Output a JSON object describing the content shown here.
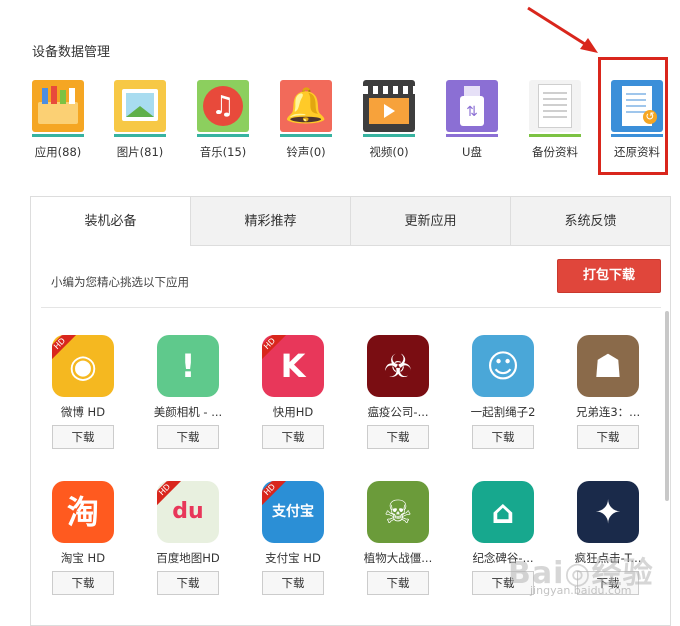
{
  "section_title": "设备数据管理",
  "categories": [
    {
      "label": "应用(88)",
      "icon": "apps-icon",
      "color": "#f5a623",
      "bar": "#37b3a0"
    },
    {
      "label": "图片(81)",
      "icon": "image-icon",
      "color": "#f7c845",
      "bar": "#37b3a0"
    },
    {
      "label": "音乐(15)",
      "icon": "music-icon",
      "color": "#e84a3b",
      "bar": "#37b3a0"
    },
    {
      "label": "铃声(0)",
      "icon": "bell-icon",
      "color": "#f26a5a",
      "bar": "#37b3a0"
    },
    {
      "label": "视频(0)",
      "icon": "video-icon",
      "color": "#3d3d3d",
      "bar": "#37b3a0"
    },
    {
      "label": "U盘",
      "icon": "usb-icon",
      "color": "#8b6fd4",
      "bar": "#8b6fd4"
    },
    {
      "label": "备份资料",
      "icon": "backup-icon",
      "color": "#7cc243",
      "bar": "#7cc243"
    },
    {
      "label": "还原资料",
      "icon": "restore-icon",
      "color": "#3b8fd9",
      "bar": "#3b8fd9"
    }
  ],
  "tabs": [
    "装机必备",
    "精彩推荐",
    "更新应用",
    "系统反馈"
  ],
  "intro": "小编为您精心挑选以下应用",
  "pack_download": "打包下载",
  "download_label": "下载",
  "apps": [
    {
      "name": "微博 HD",
      "icon": "weibo-icon",
      "color": "#f5b820",
      "glyph": "◉",
      "hd": true
    },
    {
      "name": "美颜相机 - ...",
      "icon": "meiyan-camera-icon",
      "color": "#5fc98c",
      "glyph": "!",
      "hd": false
    },
    {
      "name": "快用HD",
      "icon": "kuaiyong-icon",
      "color": "#e8375a",
      "glyph": "K",
      "hd": true
    },
    {
      "name": "瘟疫公司-...",
      "icon": "plague-icon",
      "color": "#7a0d12",
      "glyph": "☣",
      "hd": false
    },
    {
      "name": "一起割绳子2",
      "icon": "cut-the-rope-icon",
      "color": "#4aa7d8",
      "glyph": "☺",
      "hd": false
    },
    {
      "name": "兄弟连3：...",
      "icon": "brothers-in-arms-icon",
      "color": "#8a6a4a",
      "glyph": "☗",
      "hd": false
    },
    {
      "name": "淘宝 HD",
      "icon": "taobao-icon",
      "color": "#ff5a1f",
      "glyph": "淘",
      "hd": false
    },
    {
      "name": "百度地图HD",
      "icon": "baidu-map-icon",
      "color": "#e8f0df",
      "glyph": "du",
      "hd": true
    },
    {
      "name": "支付宝 HD",
      "icon": "alipay-icon",
      "color": "#2b8fd6",
      "glyph": "支付宝",
      "hd": true
    },
    {
      "name": "植物大战僵...",
      "icon": "plants-zombies-icon",
      "color": "#6b9b3a",
      "glyph": "☠",
      "hd": false
    },
    {
      "name": "纪念碑谷-...",
      "icon": "monument-valley-icon",
      "color": "#17a88e",
      "glyph": "⌂",
      "hd": false
    },
    {
      "name": "疯狂点击-T...",
      "icon": "tap-titans-icon",
      "color": "#1a2a4a",
      "glyph": "✦",
      "hd": false
    }
  ],
  "watermark": "Bai◎经验",
  "watermark_url": "jingyan.baidu.com"
}
